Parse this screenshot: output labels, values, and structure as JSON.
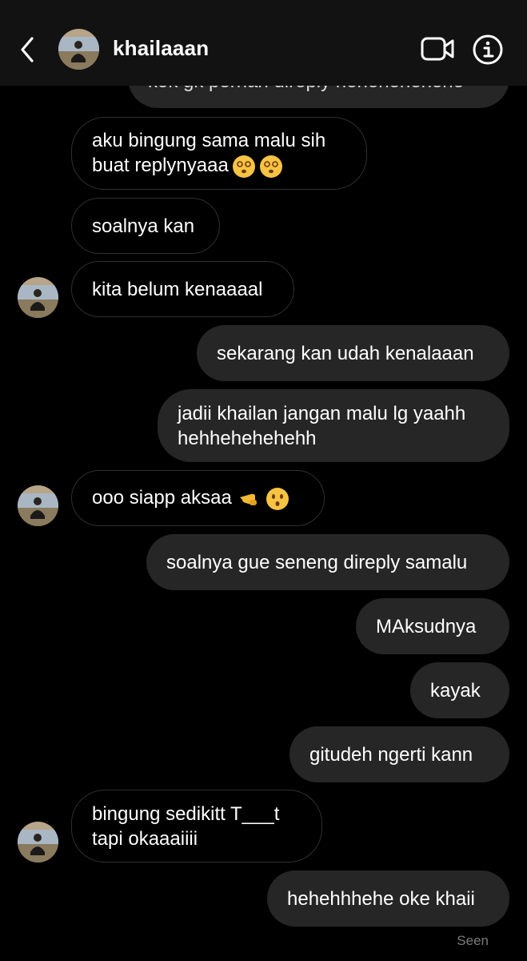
{
  "header": {
    "username": "khailaaan"
  },
  "messages": [
    {
      "id": "m0",
      "side": "out",
      "text": "kok gk pernah direply hehehehehehe"
    },
    {
      "id": "m1",
      "side": "in",
      "text": "aku bingung sama malu sih\nbuat replynyaaa",
      "emojis": [
        "dizzy-face",
        "dizzy-face"
      ]
    },
    {
      "id": "m2",
      "side": "in",
      "text": "soalnya kan"
    },
    {
      "id": "m3",
      "side": "in",
      "text": "kita belum kenaaaal"
    },
    {
      "id": "m4",
      "side": "out",
      "text": "sekarang kan udah kenalaaan"
    },
    {
      "id": "m5",
      "side": "out",
      "text": "jadii khailan jangan malu lg yaahh\nhehhehehehehh"
    },
    {
      "id": "m6",
      "side": "in",
      "text": "ooo siapp aksaa",
      "emojis": [
        "pointing-hand",
        "kissing-face"
      ]
    },
    {
      "id": "m7",
      "side": "out",
      "text": "soalnya gue seneng direply samalu"
    },
    {
      "id": "m8",
      "side": "out",
      "text": "MAksudnya"
    },
    {
      "id": "m9",
      "side": "out",
      "text": "kayak"
    },
    {
      "id": "m10",
      "side": "out",
      "text": "gitudeh ngerti kann"
    },
    {
      "id": "m11",
      "side": "in",
      "text": "bingung sedikitt T___t\ntapi okaaaiiii"
    },
    {
      "id": "m12",
      "side": "out",
      "text": "hehehhhehe oke khaii"
    }
  ],
  "status": {
    "seen_label": "Seen"
  },
  "colors": {
    "background": "#000000",
    "header": "#121212",
    "outgoing_bubble": "#262626",
    "incoming_border": "#2f2f2f"
  }
}
